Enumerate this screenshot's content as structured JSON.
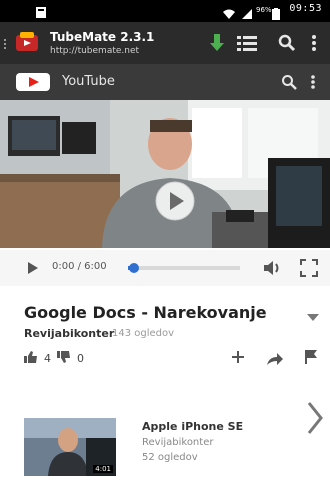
{
  "status_bar": {
    "time": "09:53",
    "battery": "96%",
    "icons": [
      "notification-icon",
      "wifi-icon",
      "signal-icon",
      "battery-icon"
    ]
  },
  "app_bar": {
    "app_name": "TubeMate 2.3.1",
    "url": "http://tubemate.net",
    "icons": [
      "tubemate-logo",
      "download-icon",
      "playlist-icon",
      "search-icon",
      "overflow-menu-icon"
    ]
  },
  "youtube_bar": {
    "title": "YouTube",
    "icons": [
      "youtube-logo",
      "search-icon",
      "overflow-menu-icon"
    ]
  },
  "player": {
    "time": "0:00 / 6:00",
    "progress": 0.05,
    "icons": [
      "play-icon",
      "volume-icon",
      "fullscreen-icon"
    ]
  },
  "video": {
    "title": "Google Docs - Narekovanje",
    "channel": "Revijabikonter",
    "views": "143 ogledov",
    "likes": "4",
    "dislikes": "0",
    "actions": [
      "add-icon",
      "share-icon",
      "flag-icon"
    ]
  },
  "related": {
    "title": "Apple iPhone SE",
    "channel": "Revijabikonter",
    "views": "52 ogledov",
    "duration": "4:01"
  },
  "colors": {
    "status_bar": "#000000",
    "app_bar": "#2b2b2b",
    "youtube_bar": "#3a3a3a",
    "download_green": "#4caf50",
    "youtube_red": "#e62117",
    "progress_blue": "#2f6fd0"
  }
}
